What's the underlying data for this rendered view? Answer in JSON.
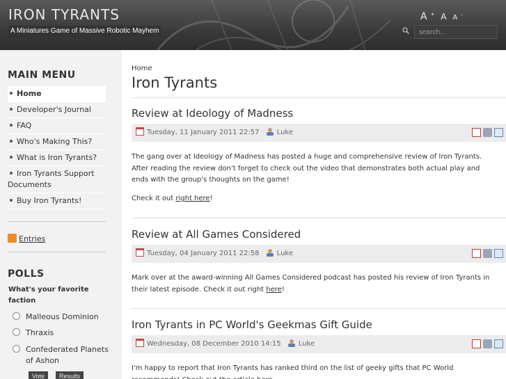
{
  "header": {
    "site_title": "IRON TYRANTS",
    "tagline": "A Miniatures Game of Massive Robotic Mayhem",
    "font_larger": "A",
    "font_larger_sup": "+",
    "font_reset": "A",
    "font_smaller": "A",
    "font_smaller_sup": "-",
    "search_placeholder": "search..."
  },
  "sidebar": {
    "main_menu_title": "MAIN MENU",
    "menu_items": [
      {
        "label": "Home"
      },
      {
        "label": "Developer's Journal"
      },
      {
        "label": "FAQ"
      },
      {
        "label": "Who's Making This?"
      },
      {
        "label": "What is Iron Tyrants?"
      },
      {
        "label": "Iron Tyrants Support"
      },
      {
        "label": "Documents"
      },
      {
        "label": "Buy Iron Tyrants!"
      }
    ],
    "rss_label": "Entries",
    "polls_title": "POLLS",
    "poll_question": "What's your favorite faction",
    "poll_options": [
      {
        "label": "Malleous Dominion"
      },
      {
        "label": "Thraxis"
      },
      {
        "label": "Confederated Planets of Ashon"
      }
    ],
    "vote_label": "Vote",
    "results_label": "Results"
  },
  "main": {
    "breadcrumb": "Home",
    "page_title": "Iron Tyrants",
    "articles": [
      {
        "title": "Review at Ideology of Madness",
        "date": "Tuesday, 11 January 2011 22:57",
        "author": "Luke",
        "p1": "The gang over at Ideology of Madness has posted a huge and comprehensive review of Iron Tyrants. After reading the review don't forget to check out the video that demonstrates both actual play and ends with the group's thoughts on the game!",
        "p2_pre": "Check it out ",
        "p2_link": "right here",
        "p2_post": "!"
      },
      {
        "title": "Review at All Games Considered",
        "date": "Tuesday, 04 January 2011 22:58",
        "author": "Luke",
        "p1_pre": "Mark over at the award-winning All Games Considered podcast has posted his review of Iron Tyrants in their latest episode.  Check it out right ",
        "p1_link": "here",
        "p1_post": "!"
      },
      {
        "title": "Iron Tyrants in PC World's Geekmas Gift Guide",
        "date": "Wednesday, 08 December 2010 14:15",
        "author": "Luke",
        "p1": "I'm happy to report that Iron Tyrants has ranked third on the list of geeky gifts that PC World recommends!  Check out the article here"
      }
    ]
  }
}
